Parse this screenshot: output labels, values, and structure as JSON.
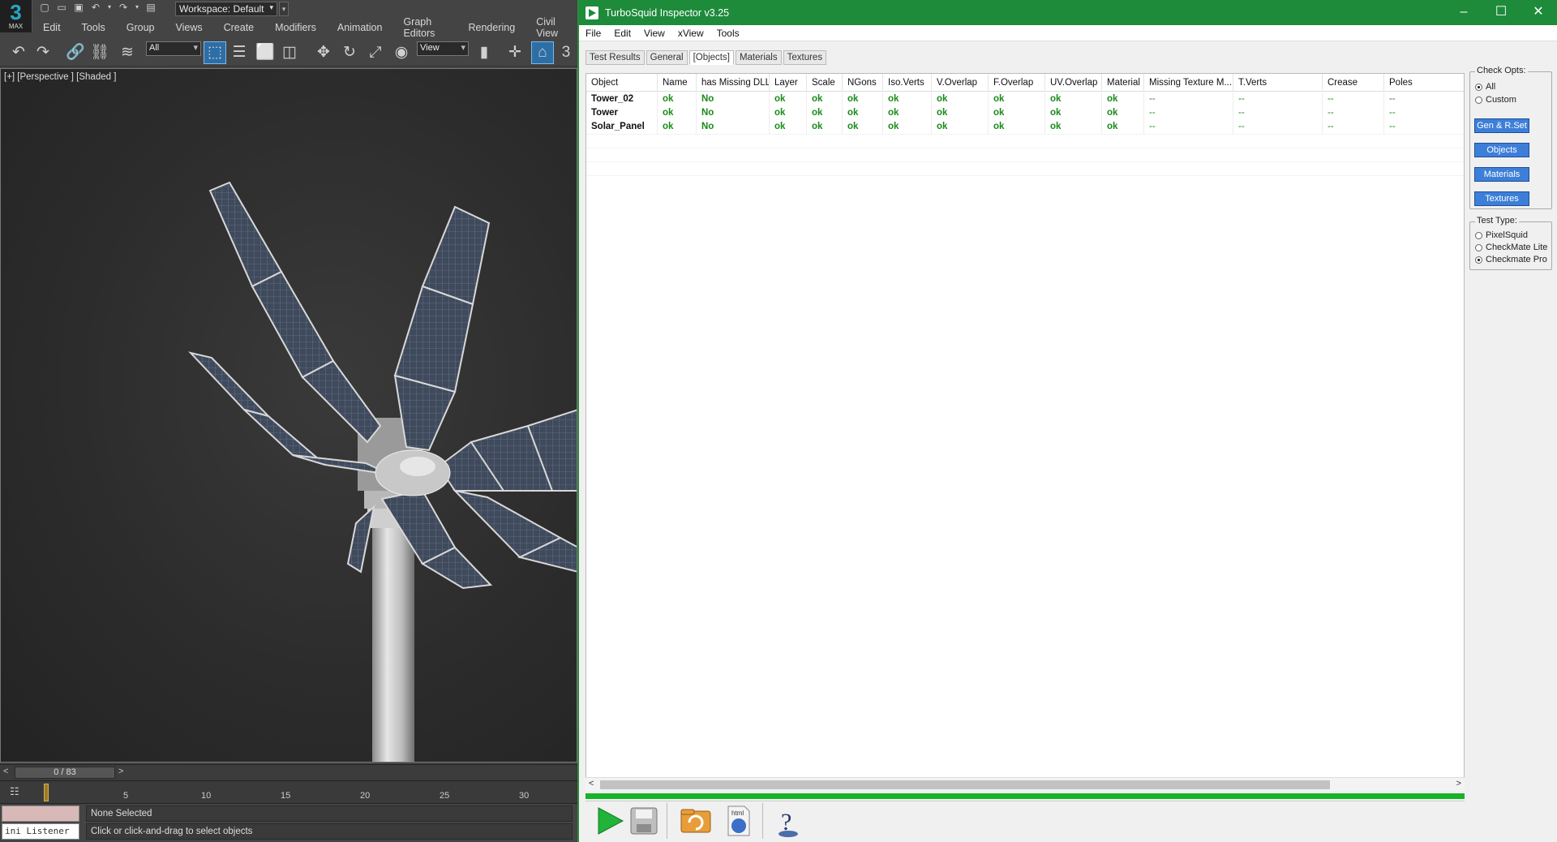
{
  "max": {
    "logo_text": "MAX",
    "workspace": "Workspace: Default",
    "menu": [
      "Edit",
      "Tools",
      "Group",
      "Views",
      "Create",
      "Modifiers",
      "Animation",
      "Graph Editors",
      "Rendering",
      "Civil View"
    ],
    "filter_dropdown": "All",
    "view_dropdown": "View",
    "toolbar_trailing_text": "3",
    "viewport_label": "[+] [Perspective ] [Shaded ]",
    "frame_counter": "0 / 83",
    "frame_prev": "<",
    "frame_next": ">",
    "track_numbers": [
      "5",
      "10",
      "15",
      "20",
      "25",
      "30"
    ],
    "listener_label": "ini Listener",
    "status_selection": "None Selected",
    "status_prompt": "Click or click-and-drag to select objects"
  },
  "inspector": {
    "title": "TurboSquid Inspector v3.25",
    "menu": [
      "File",
      "Edit",
      "View",
      "xView",
      "Tools"
    ],
    "tabs": [
      "Test Results",
      "General",
      "[Objects]",
      "Materials",
      "Textures"
    ],
    "active_tab": "[Objects]",
    "columns": [
      "Object",
      "Name",
      "has Missing DLL",
      "Layer",
      "Scale",
      "NGons",
      "Iso.Verts",
      "V.Overlap",
      "F.Overlap",
      "UV.Overlap",
      "Material",
      "Missing Texture M...",
      "T.Verts",
      "Crease",
      "Poles"
    ],
    "rows": [
      [
        "Tower_02",
        "ok",
        "No",
        "ok",
        "ok",
        "ok",
        "ok",
        "ok",
        "ok",
        "ok",
        "ok",
        "--",
        "--",
        "--",
        "--"
      ],
      [
        "Tower",
        "ok",
        "No",
        "ok",
        "ok",
        "ok",
        "ok",
        "ok",
        "ok",
        "ok",
        "ok",
        "--",
        "--",
        "--",
        "--"
      ],
      [
        "Solar_Panel",
        "ok",
        "No",
        "ok",
        "ok",
        "ok",
        "ok",
        "ok",
        "ok",
        "ok",
        "ok",
        "--",
        "--",
        "--",
        "--"
      ]
    ],
    "scroll_left": "<",
    "scroll_right": ">",
    "check_opts": {
      "title": "Check Opts:",
      "options": [
        "All",
        "Custom"
      ],
      "selected": "All",
      "buttons": [
        "Gen & R.Set",
        "Objects",
        "Materials",
        "Textures"
      ]
    },
    "test_type": {
      "title": "Test Type:",
      "options": [
        "PixelSquid",
        "CheckMate Lite",
        "Checkmate Pro"
      ],
      "selected": "Checkmate Pro"
    },
    "bottom_html_label": "html",
    "help_glyph": "?"
  },
  "colors": {
    "title_green": "#1e8b3a",
    "ok_green": "#1a8a1a",
    "button_blue": "#3d7fd8",
    "progress_green": "#19b22b"
  }
}
